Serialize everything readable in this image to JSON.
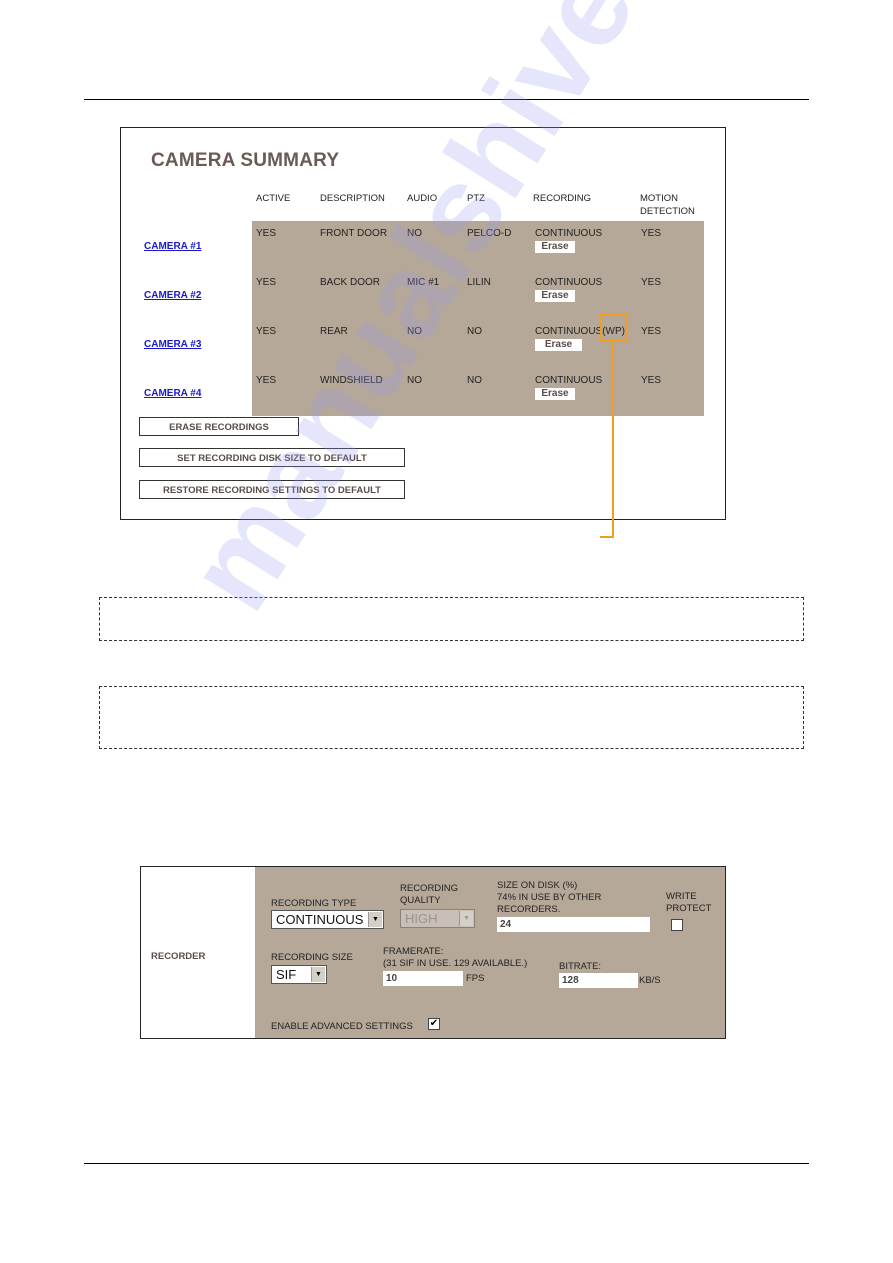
{
  "summary": {
    "title": "CAMERA SUMMARY",
    "columns": [
      "ACTIVE",
      "DESCRIPTION",
      "AUDIO",
      "PTZ",
      "RECORDING",
      "MOTION\nDETECTION"
    ],
    "columns_line1": [
      "ACTIVE",
      "DESCRIPTION",
      "AUDIO",
      "PTZ",
      "RECORDING",
      "MOTION"
    ],
    "motion_line2": "DETECTION",
    "rows": [
      {
        "camera": "CAMERA #1",
        "active": "YES",
        "description": "FRONT DOOR",
        "audio": "NO",
        "ptz": "PELCO-D",
        "recording": "CONTINUOUS",
        "erase": "Erase",
        "motion": "YES"
      },
      {
        "camera": "CAMERA #2",
        "active": "YES",
        "description": "BACK DOOR",
        "audio": "MIC #1",
        "ptz": "LILIN",
        "recording": "CONTINUOUS",
        "erase": "Erase",
        "motion": "YES"
      },
      {
        "camera": "CAMERA #3",
        "active": "YES",
        "description": "REAR",
        "audio": "NO",
        "ptz": "NO",
        "recording": "CONTINUOUS(WP)",
        "erase": "Erase",
        "motion": "YES"
      },
      {
        "camera": "CAMERA #4",
        "active": "YES",
        "description": "WINDSHIELD",
        "audio": "NO",
        "ptz": "NO",
        "recording": "CONTINUOUS",
        "erase": "Erase",
        "motion": "YES"
      }
    ],
    "buttons": {
      "erase_recordings": "ERASE RECORDINGS",
      "set_disk_default": "SET RECORDING DISK SIZE TO DEFAULT",
      "restore_default": "RESTORE RECORDING SETTINGS TO DEFAULT"
    },
    "callout_color": "#f0a020"
  },
  "recorder": {
    "label": "RECORDER",
    "recording_type": {
      "label": "RECORDING TYPE",
      "value": "CONTINUOUS"
    },
    "recording_quality": {
      "label_1": "RECORDING",
      "label_2": "QUALITY",
      "value": "HIGH",
      "disabled": true
    },
    "size_on_disk": {
      "label_1": "SIZE ON DISK (%)",
      "label_2": "74% IN USE BY OTHER",
      "label_3": "RECORDERS.",
      "value": "24"
    },
    "write_protect": {
      "label_1": "WRITE",
      "label_2": "PROTECT",
      "checked": false
    },
    "recording_size": {
      "label": "RECORDING SIZE",
      "value": "SIF"
    },
    "framerate": {
      "label_1": "FRAMERATE:",
      "label_2": "(31 SIF IN USE. 129 AVAILABLE.)",
      "value": "10",
      "unit": "FPS"
    },
    "bitrate": {
      "label": "BITRATE:",
      "value": "128",
      "unit": "KB/S"
    },
    "advanced": {
      "label": "ENABLE ADVANCED SETTINGS",
      "checked": true
    }
  },
  "colors": {
    "panel_tan": "#b6a898",
    "title": "#6b5a55",
    "link": "#1a1acc"
  },
  "watermark": "manualshive.com"
}
